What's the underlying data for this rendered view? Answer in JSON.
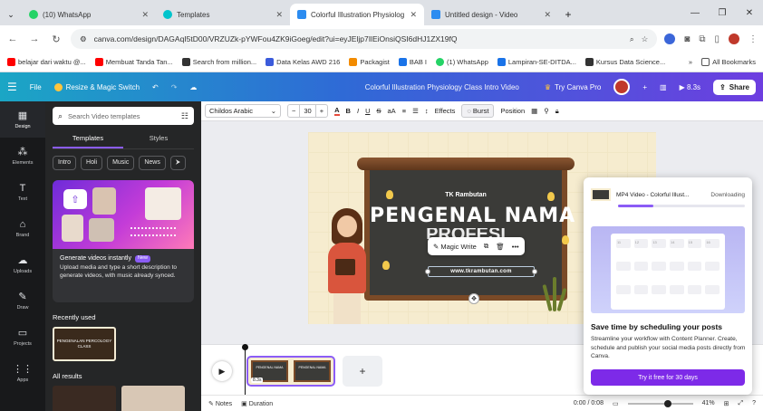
{
  "browser": {
    "tabs": [
      {
        "title": "(10) WhatsApp",
        "color": "#25d366",
        "active": false
      },
      {
        "title": "Templates",
        "color": "#00c4cc",
        "active": false
      },
      {
        "title": "Colorful Illustration Physiolog",
        "color": "#2c8cf0",
        "active": true
      },
      {
        "title": "Untitled design - Video",
        "color": "#2c8cf0",
        "active": false
      }
    ],
    "url": "canva.com/design/DAGAqI5tD00/VRZUZk-pYWFou4ZK9iGoeg/edit?ui=eyJEljp7IlEiOnsiQSI6dHJ1ZX19fQ",
    "bookmarks": [
      {
        "label": "belajar dari waktu @...",
        "color": "#ff0000"
      },
      {
        "label": "Membuat Tanda Tan...",
        "color": "#ff0000"
      },
      {
        "label": "Search from million...",
        "color": "#333333"
      },
      {
        "label": "Data Kelas AWD 216",
        "color": "#3b5bdb"
      },
      {
        "label": "Packagist",
        "color": "#f28b00"
      },
      {
        "label": "BAB I",
        "color": "#1a73e8"
      },
      {
        "label": "(1) WhatsApp",
        "color": "#25d366"
      },
      {
        "label": "Lampiran-SE-DITDA...",
        "color": "#1a73e8"
      },
      {
        "label": "Kursus Data Science...",
        "color": "#333333"
      }
    ],
    "bookmarks_more": "»",
    "all_bookmarks": "All Bookmarks"
  },
  "canva_top": {
    "file": "File",
    "resize": "Resize & Magic Switch",
    "title": "Colorful Illustration Physiology Class Intro Video",
    "try_pro": "Try Canva Pro",
    "duration": "8.3s",
    "share": "Share"
  },
  "rail": [
    {
      "label": "Design",
      "icon": "▦",
      "active": true
    },
    {
      "label": "Elements",
      "icon": "⁂",
      "active": false
    },
    {
      "label": "Text",
      "icon": "T",
      "active": false
    },
    {
      "label": "Brand",
      "icon": "⌂",
      "active": false
    },
    {
      "label": "Uploads",
      "icon": "☁",
      "active": false
    },
    {
      "label": "Draw",
      "icon": "✎",
      "active": false
    },
    {
      "label": "Projects",
      "icon": "▭",
      "active": false
    },
    {
      "label": "Apps",
      "icon": "⋮⋮",
      "active": false
    }
  ],
  "panel": {
    "search_placeholder": "Search Video templates",
    "tabs": [
      "Templates",
      "Styles"
    ],
    "chips": [
      "Intro",
      "Holi",
      "Music",
      "News"
    ],
    "promo_title": "Generate videos instantly",
    "promo_badge": "New",
    "promo_body": "Upload media and type a short description to generate videos, with music already synced.",
    "recently_used": "Recently used",
    "recent_thumb_text": "PENGENALAN PERCOLOGY CLASS",
    "all_results": "All results"
  },
  "toolbar": {
    "font": "Childos Arabic",
    "size": "30",
    "minus": "−",
    "plus": "+",
    "effects": "Effects",
    "burst": "Burst",
    "position": "Position"
  },
  "slide": {
    "school": "TK Rambutan",
    "title": "PENGENAL NAMA",
    "subtitle": "PROFESI",
    "url": "www.tkrambutan.com"
  },
  "float_toolbar": {
    "magic_write": "Magic Write"
  },
  "timeline": {
    "clip_duration": "8.3s",
    "add": "+"
  },
  "statusbar": {
    "notes": "Notes",
    "duration": "Duration",
    "time": "0:00 / 0:08",
    "zoom": "41%"
  },
  "popup": {
    "file_name": "MP4 Video - Colorful Illust...",
    "status": "Downloading",
    "progress": 0.28,
    "title": "Save time by scheduling your posts",
    "desc": "Streamline your workflow with Content Planner. Create, schedule and publish your social media posts directly from Canva.",
    "cta": "Try it free for 30 days",
    "calendar_days": [
      "11",
      "12",
      "13",
      "14",
      "15",
      "16"
    ]
  }
}
